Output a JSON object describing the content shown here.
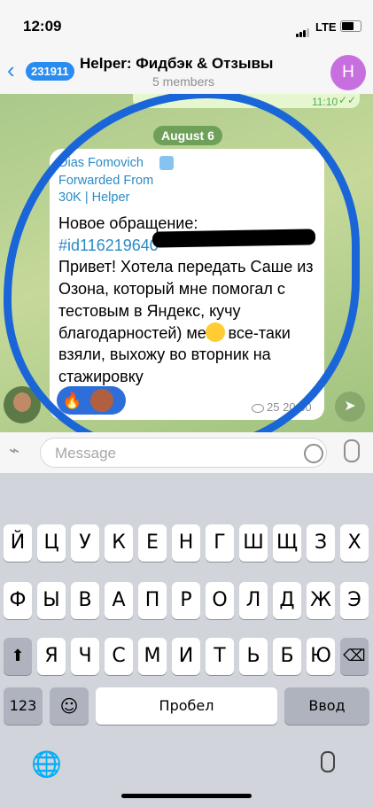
{
  "status": {
    "time": "12:09",
    "network": "LTE"
  },
  "header": {
    "back_count": "231911",
    "title": "Helper: Фидбэк & Отзывы",
    "subtitle": "5 members",
    "avatar_letter": "H"
  },
  "chat": {
    "prev_time": "11:10",
    "date": "August 6",
    "message": {
      "sender": "Dias Fomovich",
      "forwarded_label": "Forwarded From",
      "forwarded_from": "30K | Helper",
      "line1": "Новое обращение:",
      "hashtag": "#id116219640",
      "text": "Привет! Хотела передать Саше из Озона, который мне помогал с тестовым в Яндекс, кучу благодарностей) меня все-таки взяли, выхожу во вторник на стажировку",
      "reaction": "🔥",
      "views": "25",
      "time": "20:30"
    }
  },
  "input": {
    "placeholder": "Message"
  },
  "keyboard": {
    "row1": [
      "Й",
      "Ц",
      "У",
      "К",
      "Е",
      "Н",
      "Г",
      "Ш",
      "Щ",
      "З",
      "Х"
    ],
    "row2": [
      "Ф",
      "Ы",
      "В",
      "А",
      "П",
      "Р",
      "О",
      "Л",
      "Д",
      "Ж",
      "Э"
    ],
    "row3": [
      "Я",
      "Ч",
      "С",
      "М",
      "И",
      "Т",
      "Ь",
      "Б",
      "Ю"
    ],
    "numbers": "123",
    "space": "Пробел",
    "enter": "Ввод"
  }
}
